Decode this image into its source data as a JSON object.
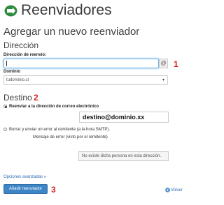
{
  "header": {
    "title": "Reenviadores",
    "icon": "forwarder-icon",
    "icon_color": "#2e8b3e"
  },
  "main_heading": "Agregar un nuevo reenviador",
  "address_section": {
    "heading": "Dirección",
    "address_label": "Dirección de reenvío:",
    "address_value": "",
    "at_addon": "@",
    "domain_label": "Dominio",
    "domain_value": "tudominio.cl"
  },
  "destination_section": {
    "heading": "Destino",
    "option_forward_label": "Reenviar a la dirección de correo electrónico",
    "forward_address": "destino@dominio.xx",
    "option_fail_label": "Borrar y enviar un error al remitente (a la hora SMTP).",
    "error_message_label": "Mensaje de error (visto por el remitente)",
    "error_message_value": "No existe dicha persona en esta dirección."
  },
  "advanced_link": "Opciones avanzadas »",
  "submit_label": "Añadir reenviador",
  "back_link": "Volver",
  "annotations": [
    "1",
    "2",
    "3"
  ],
  "colors": {
    "accent": "#3d85c6",
    "annotation": "#d22323",
    "link": "#2a6bb5"
  }
}
